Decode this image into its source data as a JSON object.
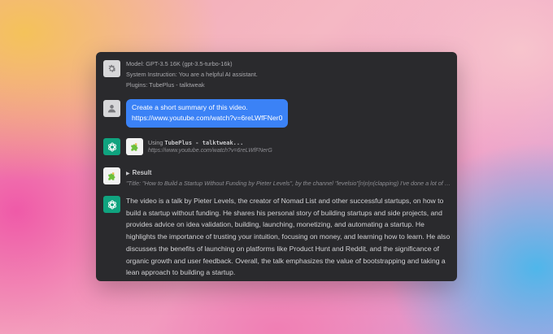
{
  "system": {
    "model": "Model: GPT-3.5 16K (gpt-3.5-turbo-16k)",
    "instruction": "System Instruction: You are a helpful AI assistant.",
    "plugins": "Plugins: TubePlus - talktweak",
    "icon": "gear-icon"
  },
  "user": {
    "message_line1": "Create a short summary of this video.",
    "message_line2": "https://www.youtube.com/watch?v=6reLWfFNer0",
    "icon": "user-icon"
  },
  "plugin_call": {
    "prefix": "Using ",
    "name": "TubePlus - talktweak...",
    "url": "https://www.youtube.com/watch?v=6reLWfFNerG",
    "icon": "puzzle-icon"
  },
  "result": {
    "label": "Result",
    "text": "\"Title: \"How to Build a Startup Without Funding by Pieter Levels\", by the channel \"levelsio\"[n|n|n(clapping) I've done a lot of things and I've built a lot of companies...\"",
    "icon": "puzzle-icon"
  },
  "answer": {
    "text": "The video is a talk by Pieter Levels, the creator of Nomad List and other successful startups, on how to build a startup without funding. He shares his personal story of building startups and side projects, and provides advice on idea validation, building, launching, monetizing, and automating a startup. He highlights the importance of trusting your intuition, focusing on money, and learning how to learn. He also discusses the benefits of launching on platforms like Product Hunt and Reddit, and the significance of organic growth and user feedback. Overall, the talk emphasizes the value of bootstrapping and taking a lean approach to building a startup.",
    "icon": "openai-icon"
  },
  "colors": {
    "window_bg": "#2a2a2d",
    "bubble_blue": "#3b82f6",
    "assistant_green": "#10a37f"
  }
}
